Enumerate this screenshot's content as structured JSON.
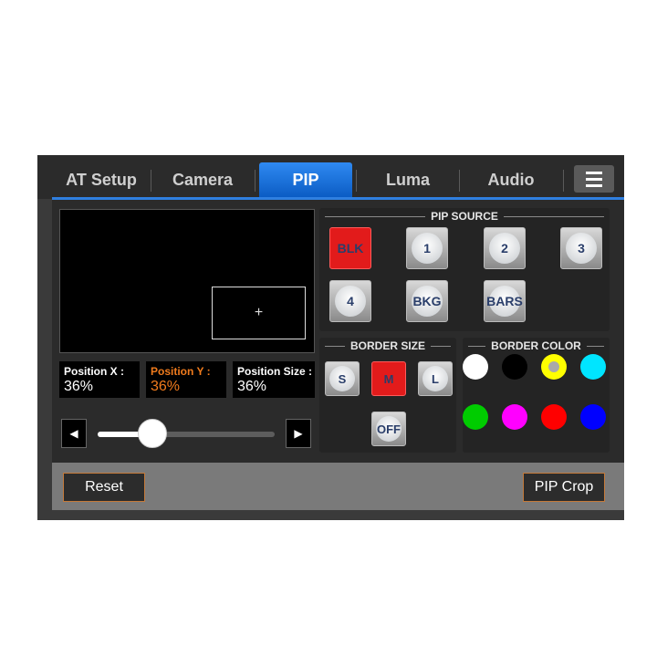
{
  "tabs": [
    {
      "label": "AT Setup"
    },
    {
      "label": "Camera"
    },
    {
      "label": "PIP"
    },
    {
      "label": "Luma"
    },
    {
      "label": "Audio"
    }
  ],
  "active_tab": "PIP",
  "menu_icon": "hamburger-menu-icon",
  "preview": {
    "crosshair": "+"
  },
  "position": {
    "x_label": "Position X :",
    "x_value": "36%",
    "y_label": "Position Y :",
    "y_value": "36%",
    "size_label": "Position Size :",
    "size_value": "36%"
  },
  "slider": {
    "value_fraction": 0.31,
    "left_icon": "arrow-left-icon",
    "right_icon": "arrow-right-icon"
  },
  "pip_source": {
    "title": "PIP SOURCE",
    "buttons": [
      "BLK",
      "1",
      "2",
      "3",
      "4",
      "BKG",
      "BARS"
    ],
    "selected": "BLK"
  },
  "border_size": {
    "title": "BORDER SIZE",
    "buttons": [
      "S",
      "M",
      "L",
      "OFF"
    ],
    "selected": "M"
  },
  "border_color": {
    "title": "BORDER COLOR",
    "colors": [
      "#ffffff",
      "#000000",
      "#ffff00",
      "#00e5ff",
      "#00cc00",
      "#ff00ff",
      "#ff0000",
      "#0000ff"
    ],
    "selected": "#ffff00"
  },
  "accent_color": "#2f7fe0",
  "footer": {
    "reset_label": "Reset",
    "pip_crop_label": "PIP Crop"
  }
}
